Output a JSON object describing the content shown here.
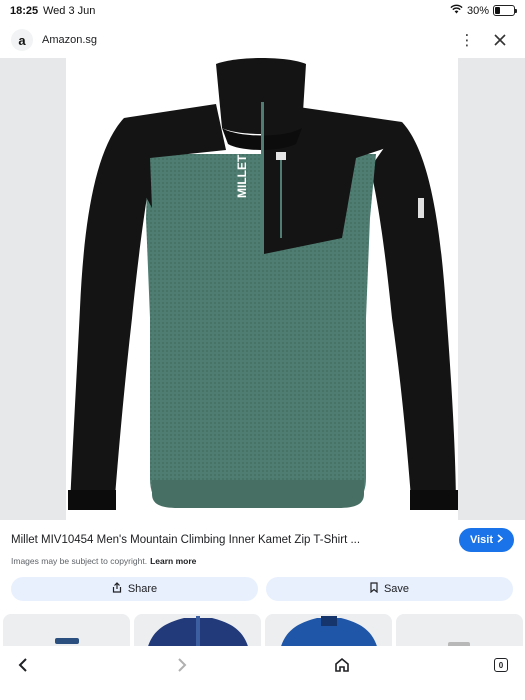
{
  "status_bar": {
    "time": "18:25",
    "date": "Wed 3 Jun",
    "battery_text": "30%",
    "battery_level": 0.3
  },
  "url_bar": {
    "site_logo_letter": "a",
    "site_name": "Amazon.sg",
    "menu_icon": "more-vert-icon",
    "close_icon": "close-icon"
  },
  "product": {
    "image_icon": "jacket-product-image",
    "brand_print": "MILLET",
    "title": "Millet MIV10454 Men's Mountain Climbing Inner Kamet Zip T-Shirt ...",
    "copyright_text": "Images may be subject to copyright.",
    "learn_more": "Learn more"
  },
  "buttons": {
    "visit": "Visit",
    "share": "Share",
    "save": "Save"
  },
  "bottom_nav": {
    "back_icon": "chevron-left-icon",
    "forward_icon": "chevron-right-icon",
    "home_icon": "home-icon",
    "tab_count": "0"
  },
  "colors": {
    "accent": "#1a73e8",
    "chip_bg": "#e8f0fe",
    "jacket_green": "#4d7a6e",
    "jacket_black": "#141414"
  }
}
